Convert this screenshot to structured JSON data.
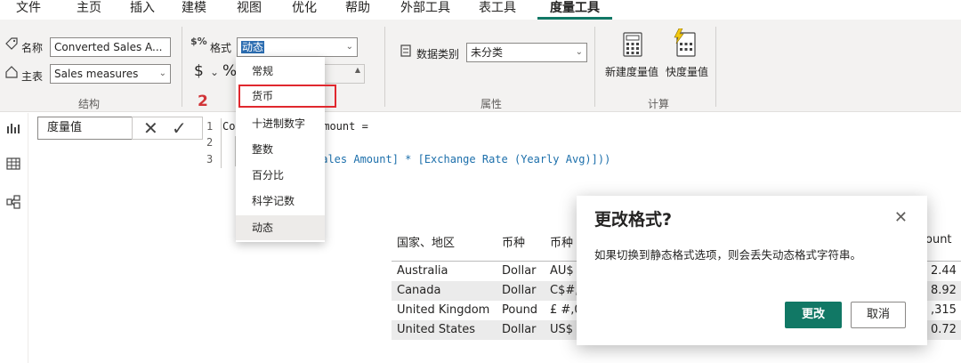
{
  "tabs": [
    "文件",
    "主页",
    "插入",
    "建模",
    "视图",
    "优化",
    "帮助",
    "外部工具",
    "表工具",
    "度量工具"
  ],
  "ribbon": {
    "structure": {
      "name_label": "名称",
      "name_value": "Converted Sales A...",
      "home_label": "主表",
      "home_value": "Sales measures",
      "group_label": "结构"
    },
    "format": {
      "format_label": "格式",
      "format_value": "动态",
      "dollar_symbol": "$",
      "percent_symbol": "%"
    },
    "properties": {
      "category_label": "数据类别",
      "category_value": "未分类",
      "group_label": "属性"
    },
    "calculations": {
      "new_measure": "新建度量值",
      "quick_measure": "快度量值",
      "group_label": "计算"
    }
  },
  "format_menu": {
    "items": [
      "常规",
      "货币",
      "十进制数字",
      "整数",
      "百分比",
      "科学记数",
      "动态"
    ],
    "selected": "动态"
  },
  "steps": {
    "two": "2",
    "three": "3"
  },
  "formula": {
    "dropdown_value": "度量值",
    "line_numbers": [
      "1",
      "2",
      "3"
    ],
    "line1_start": "Con",
    "line1_end": "Amount =",
    "line3_text": "Sales Amount] * [Exchange Rate (Yearly Avg)]))"
  },
  "table": {
    "headers": [
      "国家、地区",
      "币种",
      "币种",
      "ount"
    ],
    "rows": [
      {
        "country": "Australia",
        "currency": "Dollar",
        "fmt": "AU$",
        "value": "2.44"
      },
      {
        "country": "Canada",
        "currency": "Dollar",
        "fmt": "C$#,",
        "value": "8.92"
      },
      {
        "country": "United Kingdom",
        "currency": "Pound",
        "fmt": "£ #,0",
        "value": ",315"
      },
      {
        "country": "United States",
        "currency": "Dollar",
        "fmt": "US$",
        "value": "0.72"
      }
    ]
  },
  "dialog": {
    "title": "更改格式?",
    "message": "如果切换到静态格式选项，则会丢失动态格式字符串。",
    "confirm": "更改",
    "cancel": "取消"
  },
  "colors": {
    "accent": "#117865",
    "highlight": "#e0282e",
    "step": "#d13438"
  }
}
